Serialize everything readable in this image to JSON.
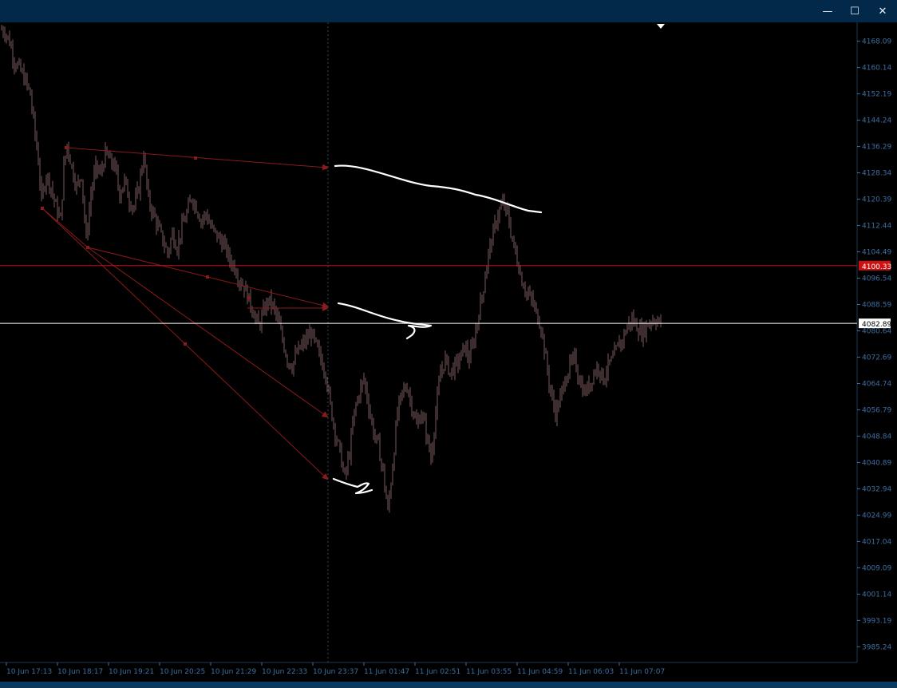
{
  "window": {
    "minimize_glyph": "—",
    "maximize_glyph": "☐",
    "close_glyph": "✕"
  },
  "chart_data": {
    "type": "candlestick",
    "title": "",
    "xlabel": "",
    "ylabel": "",
    "ylim": [
      3980.5,
      4173.3
    ],
    "y_ticks": [
      "4168.09",
      "4160.14",
      "4152.19",
      "4144.24",
      "4136.29",
      "4128.34",
      "4120.39",
      "4112.44",
      "4104.49",
      "4096.54",
      "4088.59",
      "4080.64",
      "4072.69",
      "4064.74",
      "4056.79",
      "4048.84",
      "4040.89",
      "4032.94",
      "4024.99",
      "4017.04",
      "4009.09",
      "4001.14",
      "3993.19",
      "3985.24"
    ],
    "x_ticks": [
      "10 Jun 17:13",
      "10 Jun 18:17",
      "10 Jun 19:21",
      "10 Jun 20:25",
      "10 Jun 21:29",
      "10 Jun 22:33",
      "10 Jun 23:37",
      "11 Jun 01:47",
      "11 Jun 02:51",
      "11 Jun 03:55",
      "11 Jun 04:59",
      "11 Jun 06:03",
      "11 Jun 07:07"
    ],
    "price_path": [
      [
        0,
        4172
      ],
      [
        6,
        4171
      ],
      [
        12,
        4168
      ],
      [
        18,
        4162
      ],
      [
        24,
        4160
      ],
      [
        32,
        4156
      ],
      [
        38,
        4152
      ],
      [
        44,
        4140
      ],
      [
        48,
        4132
      ],
      [
        52,
        4120
      ],
      [
        58,
        4128
      ],
      [
        64,
        4124
      ],
      [
        70,
        4118
      ],
      [
        76,
        4114
      ],
      [
        80,
        4130
      ],
      [
        84,
        4137
      ],
      [
        90,
        4130
      ],
      [
        96,
        4124
      ],
      [
        102,
        4128
      ],
      [
        108,
        4108
      ],
      [
        114,
        4122
      ],
      [
        120,
        4130
      ],
      [
        126,
        4128
      ],
      [
        132,
        4134
      ],
      [
        138,
        4132
      ],
      [
        144,
        4130
      ],
      [
        150,
        4122
      ],
      [
        156,
        4126
      ],
      [
        162,
        4120
      ],
      [
        168,
        4118
      ],
      [
        174,
        4124
      ],
      [
        180,
        4134
      ],
      [
        186,
        4120
      ],
      [
        192,
        4116
      ],
      [
        198,
        4112
      ],
      [
        204,
        4108
      ],
      [
        210,
        4104
      ],
      [
        216,
        4110
      ],
      [
        222,
        4106
      ],
      [
        228,
        4112
      ],
      [
        234,
        4116
      ],
      [
        240,
        4121
      ],
      [
        246,
        4118
      ],
      [
        252,
        4114
      ],
      [
        258,
        4116
      ],
      [
        264,
        4112
      ],
      [
        270,
        4110
      ],
      [
        276,
        4108
      ],
      [
        282,
        4106
      ],
      [
        288,
        4102
      ],
      [
        294,
        4100
      ],
      [
        300,
        4096
      ],
      [
        306,
        4094
      ],
      [
        312,
        4090
      ],
      [
        318,
        4086
      ],
      [
        324,
        4082
      ],
      [
        330,
        4086
      ],
      [
        336,
        4090
      ],
      [
        342,
        4088
      ],
      [
        348,
        4084
      ],
      [
        354,
        4078
      ],
      [
        360,
        4072
      ],
      [
        366,
        4070
      ],
      [
        372,
        4074
      ],
      [
        378,
        4076
      ],
      [
        384,
        4078
      ],
      [
        390,
        4080
      ],
      [
        396,
        4076
      ],
      [
        402,
        4072
      ],
      [
        408,
        4068
      ],
      [
        414,
        4058
      ],
      [
        420,
        4050
      ],
      [
        426,
        4044
      ],
      [
        432,
        4036
      ],
      [
        438,
        4044
      ],
      [
        444,
        4056
      ],
      [
        450,
        4062
      ],
      [
        456,
        4066
      ],
      [
        462,
        4058
      ],
      [
        468,
        4050
      ],
      [
        474,
        4046
      ],
      [
        480,
        4038
      ],
      [
        486,
        4026
      ],
      [
        492,
        4040
      ],
      [
        498,
        4056
      ],
      [
        504,
        4062
      ],
      [
        510,
        4064
      ],
      [
        516,
        4058
      ],
      [
        522,
        4052
      ],
      [
        528,
        4056
      ],
      [
        534,
        4050
      ],
      [
        540,
        4042
      ],
      [
        546,
        4056
      ],
      [
        552,
        4068
      ],
      [
        558,
        4072
      ],
      [
        564,
        4068
      ],
      [
        570,
        4070
      ],
      [
        576,
        4072
      ],
      [
        582,
        4076
      ],
      [
        588,
        4072
      ],
      [
        594,
        4078
      ],
      [
        600,
        4086
      ],
      [
        606,
        4094
      ],
      [
        612,
        4104
      ],
      [
        618,
        4110
      ],
      [
        624,
        4116
      ],
      [
        630,
        4119
      ],
      [
        636,
        4116
      ],
      [
        642,
        4108
      ],
      [
        648,
        4102
      ],
      [
        654,
        4096
      ],
      [
        660,
        4092
      ],
      [
        666,
        4090
      ],
      [
        672,
        4086
      ],
      [
        678,
        4082
      ],
      [
        684,
        4072
      ],
      [
        690,
        4062
      ],
      [
        696,
        4056
      ],
      [
        702,
        4060
      ],
      [
        708,
        4066
      ],
      [
        714,
        4070
      ],
      [
        720,
        4072
      ],
      [
        726,
        4066
      ],
      [
        732,
        4062
      ],
      [
        738,
        4064
      ],
      [
        744,
        4068
      ],
      [
        750,
        4070
      ],
      [
        756,
        4066
      ],
      [
        762,
        4070
      ],
      [
        768,
        4072
      ],
      [
        774,
        4076
      ],
      [
        780,
        4078
      ],
      [
        786,
        4082
      ],
      [
        792,
        4084
      ],
      [
        798,
        4082
      ],
      [
        804,
        4080
      ],
      [
        810,
        4082
      ],
      [
        816,
        4084
      ],
      [
        822,
        4084
      ],
      [
        828,
        4082.89
      ]
    ],
    "horizontal_lines": [
      {
        "price": 4100.33,
        "label": "4100.33",
        "color": "#cc1111",
        "label_bg": "#cc1111",
        "label_color": "#ffffff"
      },
      {
        "price": 4082.89,
        "label": "4082.89",
        "color": "#ffffff",
        "label_bg": "#ffffff",
        "label_color": "#000000"
      }
    ],
    "colors": {
      "background": "#000000",
      "candles": "#7a5a5c",
      "axis_text": "#3d6fa3",
      "trendlines": "#8b1a1a",
      "annotation": "#ffffff",
      "frame": "#1e3a56"
    }
  }
}
